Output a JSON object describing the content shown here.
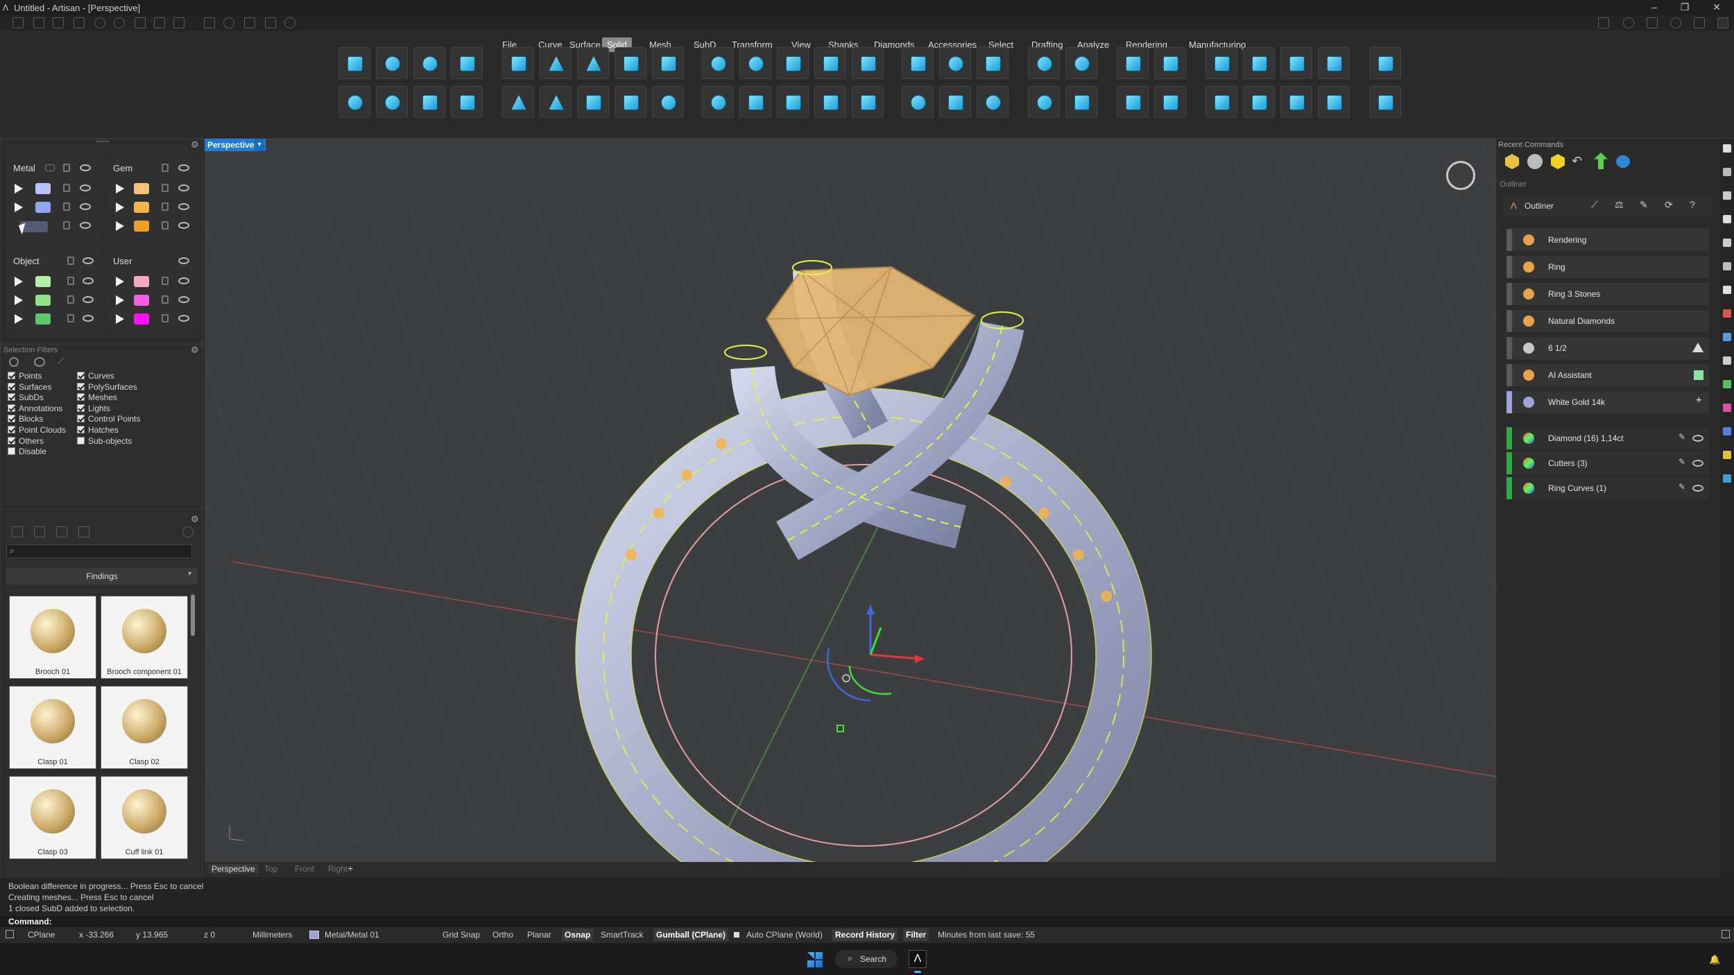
{
  "titlebar": {
    "title": "Untitled - Artisan - [Perspective]"
  },
  "colors": {
    "accent": "#1e7bd8",
    "wire": "#e6f24a",
    "metal": "#aab3cf",
    "gem": "#e8b870"
  },
  "menus": [
    "File",
    "Curve",
    "Surface",
    "Solid",
    "Mesh",
    "SubD",
    "Transform",
    "View",
    "Shanks",
    "Diamonds",
    "Accessories",
    "Select",
    "Drafting",
    "Analyze",
    "Rendering",
    "Manufacturing"
  ],
  "active_menu": "Solid",
  "layers": {
    "metal": {
      "title": "Metal"
    },
    "gem": {
      "title": "Gem"
    },
    "object": {
      "title": "Object"
    },
    "user": {
      "title": "User"
    }
  },
  "selection_filters": {
    "title": "Selection Filters",
    "left": [
      {
        "label": "Points",
        "checked": true
      },
      {
        "label": "Surfaces",
        "checked": true
      },
      {
        "label": "SubDs",
        "checked": true
      },
      {
        "label": "Annotations",
        "checked": true
      },
      {
        "label": "Blocks",
        "checked": true
      },
      {
        "label": "Point Clouds",
        "checked": true
      },
      {
        "label": "Others",
        "checked": true
      },
      {
        "label": "Disable",
        "checked": false
      }
    ],
    "right": [
      {
        "label": "Curves",
        "checked": true
      },
      {
        "label": "PolySurfaces",
        "checked": true
      },
      {
        "label": "Meshes",
        "checked": true
      },
      {
        "label": "Lights",
        "checked": true
      },
      {
        "label": "Control Points",
        "checked": true
      },
      {
        "label": "Hatches",
        "checked": true
      },
      {
        "label": "Sub-objects",
        "checked": false
      }
    ]
  },
  "library": {
    "category": "Findings",
    "items": [
      "Brooch 01",
      "Brooch component 01",
      "Clasp 01",
      "Clasp 02",
      "Clasp 03",
      "Cuff link 01"
    ]
  },
  "viewport": {
    "active": "Perspective",
    "tabs": [
      "Perspective",
      "Top",
      "Front",
      "Right"
    ],
    "add_tab": "+"
  },
  "right_panel": {
    "recent_commands": "Recent Commands",
    "outliner_header": "Outliner",
    "outliner_title": "Outliner",
    "items": [
      {
        "label": "Rendering",
        "color": "#e8a24a",
        "icon": "render-icon"
      },
      {
        "label": "Ring",
        "color": "#e8a24a",
        "icon": "ring-icon"
      },
      {
        "label": "Ring 3 Stones",
        "color": "#e8a24a",
        "icon": "stones-icon"
      },
      {
        "label": "Natural Diamonds",
        "color": "#e8a24a",
        "icon": "diamond-icon"
      },
      {
        "label": "6 1/2",
        "color": "#c8c8c8",
        "icon": "flag-icon"
      },
      {
        "label": "AI Assistant",
        "color": "#e8a24a",
        "icon": "assistant-icon"
      },
      {
        "label": "White Gold 14k",
        "color": "#9aa4d8",
        "icon": "material-icon"
      }
    ],
    "objects": [
      {
        "label": "Diamond (16) 1,14ct",
        "color": "#2faa4a"
      },
      {
        "label": "Cutters (3)",
        "color": "#2faa4a"
      },
      {
        "label": "Ring Curves (1)",
        "color": "#2faa4a"
      }
    ]
  },
  "command_history": [
    "Boolean difference in progress... Press Esc to cancel",
    "Creating meshes... Press Esc to cancel",
    "1 closed SubD added to selection."
  ],
  "command_prompt": "Command:",
  "statusbar": {
    "cplane": "CPlane",
    "x": "x -33.266",
    "y": "y 13.965",
    "z": "z 0",
    "units": "Millimeters",
    "layer": "Metal/Metal 01",
    "grid_snap": "Grid Snap",
    "ortho": "Ortho",
    "planar": "Planar",
    "osnap": "Osnap",
    "smarttrack": "SmartTrack",
    "gumball": "Gumball (CPlane)",
    "auto_cplane": "Auto CPlane (World)",
    "record_history": "Record History",
    "filter": "Filter",
    "last_save": "Minutes from last save: 55"
  },
  "taskbar": {
    "search": "Search"
  }
}
